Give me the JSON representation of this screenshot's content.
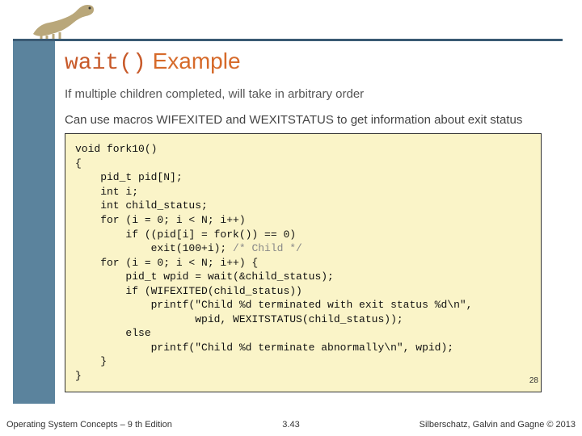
{
  "title": {
    "code": "wait()",
    "word": "Example"
  },
  "desc1": "If multiple children completed, will take in arbitrary order",
  "desc2": "Can use macros WIFEXITED and WEXITSTATUS to get information about exit status",
  "code": {
    "l1": "void fork10()",
    "l2": "{",
    "l3": "    pid_t pid[N];",
    "l4": "    int i;",
    "l5": "    int child_status;",
    "l6": "    for (i = 0; i < N; i++)",
    "l7a": "        if ((pid[i] = fork()) == 0)",
    "l8a": "            exit(100+i); ",
    "l8b": "/* Child */",
    "l9": "    for (i = 0; i < N; i++) {",
    "l10": "        pid_t wpid = wait(&child_status);",
    "l11": "        if (WIFEXITED(child_status))",
    "l12": "            printf(\"Child %d terminated with exit status %d\\n\",",
    "l13": "                   wpid, WEXITSTATUS(child_status));",
    "l14": "        else",
    "l15": "            printf(\"Child %d terminate abnormally\\n\", wpid);",
    "l16": "    }",
    "l17": "}"
  },
  "inner_page": "28",
  "footer": {
    "left": "Operating System Concepts – 9 th Edition",
    "center": "3.43",
    "right": "Silberschatz, Galvin and Gagne © 2013"
  }
}
